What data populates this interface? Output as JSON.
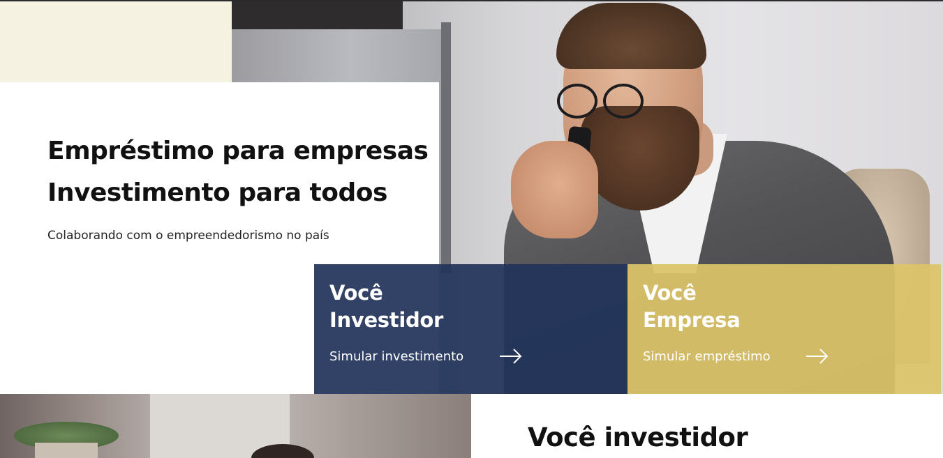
{
  "hero": {
    "headline_line1": "Empréstimo para empresas",
    "headline_line2": "Investimento para todos",
    "subtitle": "Colaborando com o empreendedorismo no país"
  },
  "cards": {
    "investor": {
      "title_line1": "Você",
      "title_line2": "Investidor",
      "link": "Simular investimento",
      "color": "#21345a"
    },
    "company": {
      "title_line1": "Você",
      "title_line2": "Empresa",
      "link": "Simular empréstimo",
      "color": "#dbc468"
    }
  },
  "section": {
    "title": "Você investidor"
  },
  "colors": {
    "cream": "#f6f2e2",
    "text": "#111111"
  },
  "icons": {
    "cta_arrow": "arrow-right-icon"
  }
}
